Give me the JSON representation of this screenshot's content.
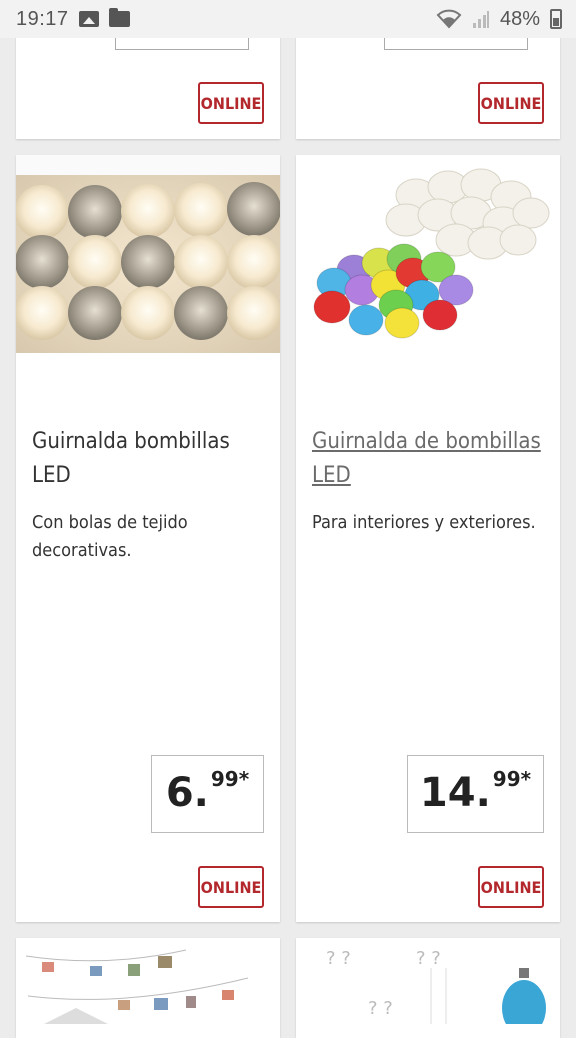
{
  "status_bar": {
    "time": "19:17",
    "battery": "48%"
  },
  "badges": {
    "online": "ONLINE"
  },
  "products": [
    {
      "title": "Guirnalda bombillas LED",
      "description": "Con bolas de tejido decorativas.",
      "price_int": "6.",
      "price_dec": "99*"
    },
    {
      "title": "Guirnalda de bombillas LED",
      "description": "Para interiores y exteriores.",
      "price_int": "14.",
      "price_dec": "99*"
    }
  ],
  "colors": {
    "accent_red": "#b3282d",
    "background": "#ececec",
    "card": "#ffffff"
  }
}
